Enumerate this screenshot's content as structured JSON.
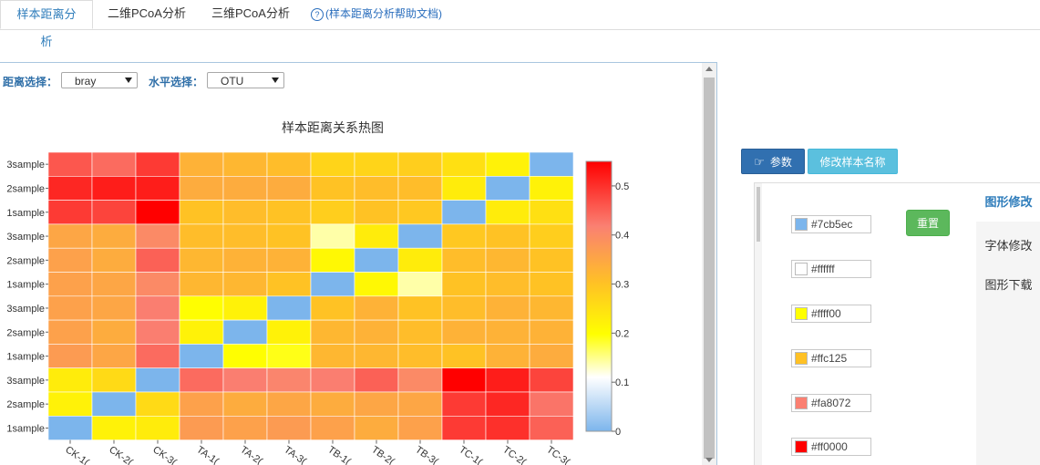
{
  "tabs": [
    {
      "label": "样本距离分析"
    },
    {
      "label": "二维PCoA分析"
    },
    {
      "label": "三维PCoA分析"
    },
    {
      "label": "(样本距离分析帮助文档)"
    }
  ],
  "help_icon": {
    "glyph": "?",
    "icon": "question-circle-icon"
  },
  "controls": {
    "distance_label": "距离选择：",
    "distance_value": "bray",
    "level_label": "水平选择：",
    "level_value": "OTU"
  },
  "chart_data": {
    "type": "heatmap",
    "title": "样本距离关系热图",
    "rows": [
      "3sample",
      "2sample",
      "1sample",
      "3sample",
      "2sample",
      "1sample",
      "3sample",
      "2sample",
      "1sample",
      "3sample",
      "2sample",
      "1sample"
    ],
    "columns": [
      "CK-1",
      "CK-2",
      "CK-3",
      "TA-1",
      "TA-2",
      "TA-3",
      "TB-1",
      "TB-2",
      "TB-3",
      "TC-1",
      "TC-2",
      "TC-3"
    ],
    "column_labels_visible": [
      "CK-1(",
      "CK-2(",
      "CK-3(",
      "TA-1(",
      "TA-2(",
      "TA-3(",
      "TB-1(",
      "TB-2(",
      "TB-3(",
      "TC-1(",
      "TC-2(",
      "TC-3("
    ],
    "values": [
      [
        0.46,
        0.44,
        0.49,
        0.33,
        0.32,
        0.31,
        0.27,
        0.27,
        0.28,
        0.25,
        0.22,
        0.0
      ],
      [
        0.51,
        0.52,
        0.52,
        0.34,
        0.34,
        0.34,
        0.3,
        0.31,
        0.31,
        0.23,
        0.0,
        0.22
      ],
      [
        0.49,
        0.48,
        0.55,
        0.3,
        0.31,
        0.3,
        0.28,
        0.3,
        0.29,
        0.0,
        0.23,
        0.25
      ],
      [
        0.35,
        0.34,
        0.4,
        0.31,
        0.31,
        0.3,
        0.14,
        0.23,
        0.0,
        0.29,
        0.3,
        0.28
      ],
      [
        0.36,
        0.34,
        0.45,
        0.32,
        0.33,
        0.33,
        0.21,
        0.0,
        0.23,
        0.31,
        0.32,
        0.3
      ],
      [
        0.36,
        0.35,
        0.4,
        0.32,
        0.32,
        0.3,
        0.0,
        0.21,
        0.14,
        0.3,
        0.31,
        0.3
      ],
      [
        0.36,
        0.35,
        0.42,
        0.2,
        0.22,
        0.0,
        0.3,
        0.33,
        0.3,
        0.31,
        0.33,
        0.32
      ],
      [
        0.36,
        0.34,
        0.42,
        0.22,
        0.0,
        0.22,
        0.32,
        0.33,
        0.31,
        0.33,
        0.33,
        0.33
      ],
      [
        0.37,
        0.35,
        0.44,
        0.0,
        0.2,
        0.19,
        0.32,
        0.32,
        0.31,
        0.3,
        0.33,
        0.34
      ],
      [
        0.23,
        0.26,
        0.0,
        0.44,
        0.42,
        0.41,
        0.42,
        0.45,
        0.4,
        0.55,
        0.52,
        0.48
      ],
      [
        0.22,
        0.0,
        0.26,
        0.36,
        0.34,
        0.35,
        0.34,
        0.35,
        0.35,
        0.49,
        0.51,
        0.43
      ],
      [
        0.0,
        0.22,
        0.23,
        0.37,
        0.36,
        0.37,
        0.36,
        0.34,
        0.36,
        0.49,
        0.5,
        0.45
      ]
    ],
    "colorbar": {
      "min": 0,
      "max": 0.55,
      "ticks": [
        0,
        0.1,
        0.2,
        0.3,
        0.4,
        0.5
      ]
    },
    "colors": [
      "#7cb5ec",
      "#ffffff",
      "#ffff00",
      "#ffc125",
      "#fa8072",
      "#ff0000"
    ]
  },
  "buttons": {
    "params_label": "参数",
    "params_icon": "hand-pointer-icon",
    "rename_label": "修改样本名称",
    "reset_label": "重置"
  },
  "color_settings": [
    {
      "value": "#7cb5ec"
    },
    {
      "value": "#ffffff"
    },
    {
      "value": "#ffff00"
    },
    {
      "value": "#ffc125"
    },
    {
      "value": "#fa8072"
    },
    {
      "value": "#ff0000"
    }
  ],
  "side_tabs": [
    {
      "label": "图形修改"
    },
    {
      "label": "字体修改"
    },
    {
      "label": "图形下载"
    }
  ]
}
